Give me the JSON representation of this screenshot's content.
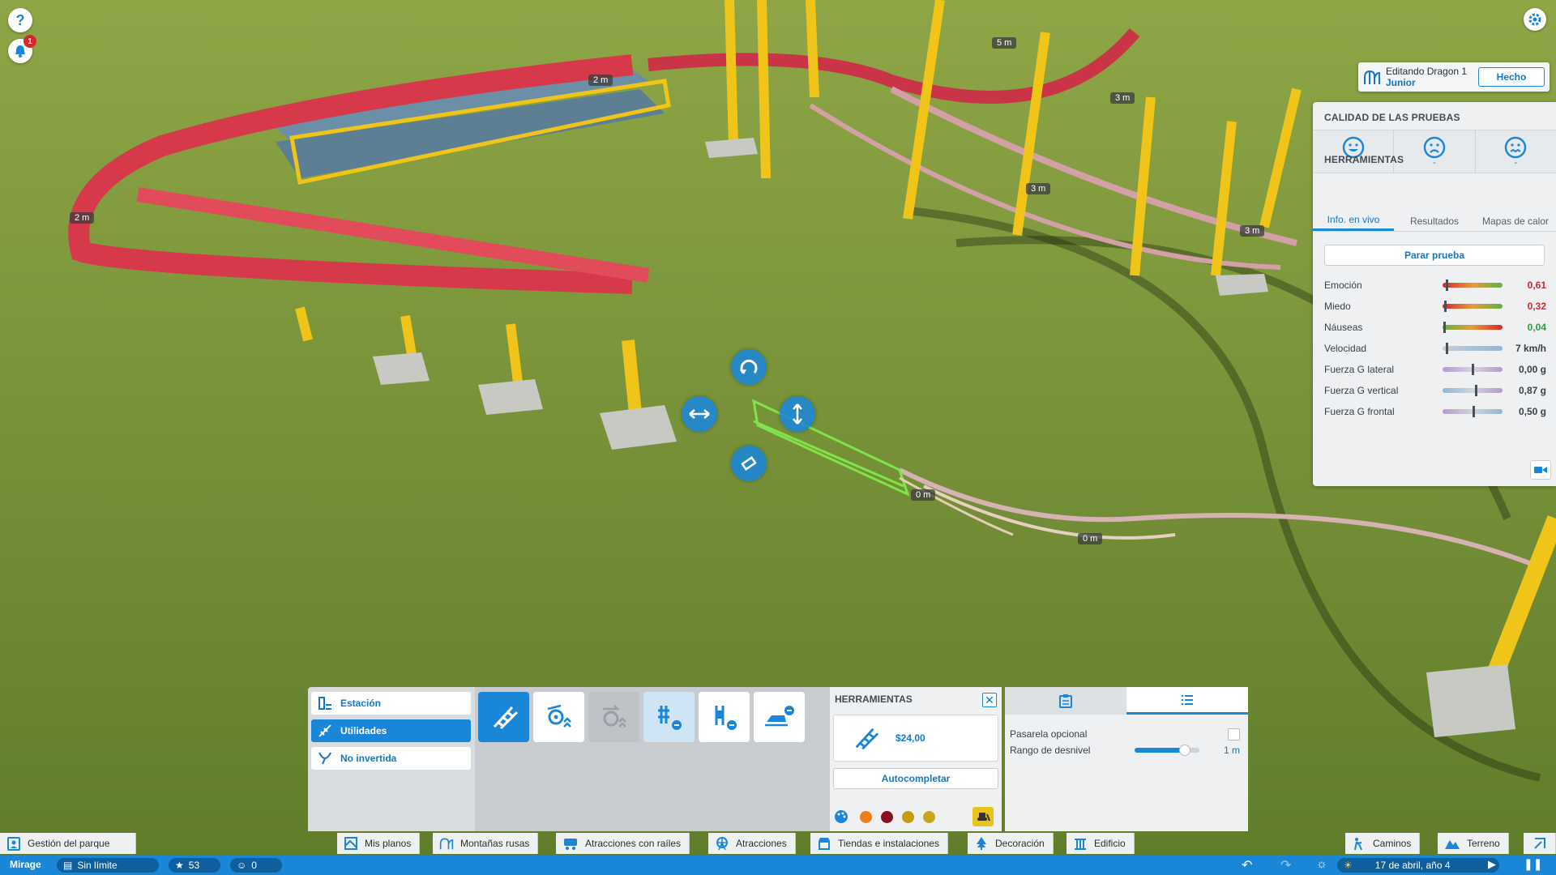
{
  "hud": {
    "help_icon": "question-icon",
    "notifications_count": "1",
    "settings_icon": "gear-icon"
  },
  "editing": {
    "title": "Editando Dragon 1",
    "subtitle": "Junior",
    "done_label": "Hecho"
  },
  "stats_panel": {
    "quality_title": "CALIDAD DE LAS PRUEBAS",
    "faces": [
      {
        "icon": "happy-face-icon",
        "value": "-"
      },
      {
        "icon": "scared-face-icon",
        "value": "-"
      },
      {
        "icon": "sick-face-icon",
        "value": "-"
      }
    ],
    "tools_title": "HERRAMIENTAS",
    "tabs": [
      "Info. en vivo",
      "Resultados",
      "Mapas de calor"
    ],
    "active_tab": 0,
    "stop_label": "Parar prueba",
    "stats": [
      {
        "label": "Emoción",
        "value": "0,61",
        "value_color": "#d8262e",
        "level": 0.05
      },
      {
        "label": "Miedo",
        "value": "0,32",
        "value_color": "#d8262e",
        "level": 0.03
      },
      {
        "label": "Náuseas",
        "value": "0,04",
        "value_color": "#2ea043",
        "level": 0.01
      },
      {
        "label": "Velocidad",
        "value": "7 km/h",
        "value_color": "#3a4048",
        "level": 0.05
      },
      {
        "label": "Fuerza G lateral",
        "value": "0,00 g",
        "value_color": "#3a4048",
        "level": 0.5
      },
      {
        "label": "Fuerza G vertical",
        "value": "0,87 g",
        "value_color": "#3a4048",
        "level": 0.55
      },
      {
        "label": "Fuerza G frontal",
        "value": "0,50 g",
        "value_color": "#3a4048",
        "level": 0.52
      }
    ]
  },
  "categories": [
    {
      "label": "Estación",
      "icon": "station-icon"
    },
    {
      "label": "Utilidades",
      "icon": "utilities-icon"
    },
    {
      "label": "No invertida",
      "icon": "non-inverted-icon"
    }
  ],
  "active_category": 1,
  "tool_buttons": [
    "track-piece-icon",
    "lift-wheel-icon",
    "booster-wheel-icon",
    "brake-remove-icon",
    "block-brake-remove-icon",
    "train-remove-icon"
  ],
  "tools": {
    "title": "HERRAMIENTAS",
    "price": "$24,00",
    "autocomplete_label": "Autocompletar",
    "swatches": [
      "#f07d1a",
      "#8a1020",
      "#c89a10",
      "#c8a51a"
    ]
  },
  "options": {
    "rows": [
      {
        "label": "Pasarela opcional"
      },
      {
        "label": "Rango de desnivel",
        "value": "1 m",
        "level": 0.78
      }
    ]
  },
  "menubar": {
    "park_management": "Gestión del parque",
    "items": [
      "Mis planos",
      "Montañas rusas",
      "Atracciones con raíles",
      "Atracciones",
      "Tiendas e instalaciones",
      "Decoración",
      "Edificio"
    ],
    "right_items": [
      "Caminos",
      "Terreno"
    ]
  },
  "statusbar": {
    "park_name": "Mirage",
    "budget": "Sin límite",
    "rating": "53",
    "guests": "0",
    "date": "17 de abril, año 4"
  },
  "distance_labels": [
    "2 m",
    "2 m",
    "5 m",
    "3 m",
    "3 m",
    "3 m",
    "0 m",
    "0 m"
  ],
  "colors": {
    "accent": "#1a86d8",
    "track_red": "#d63a4a",
    "support_yellow": "#f0c419",
    "grass": "#6e8b32"
  }
}
